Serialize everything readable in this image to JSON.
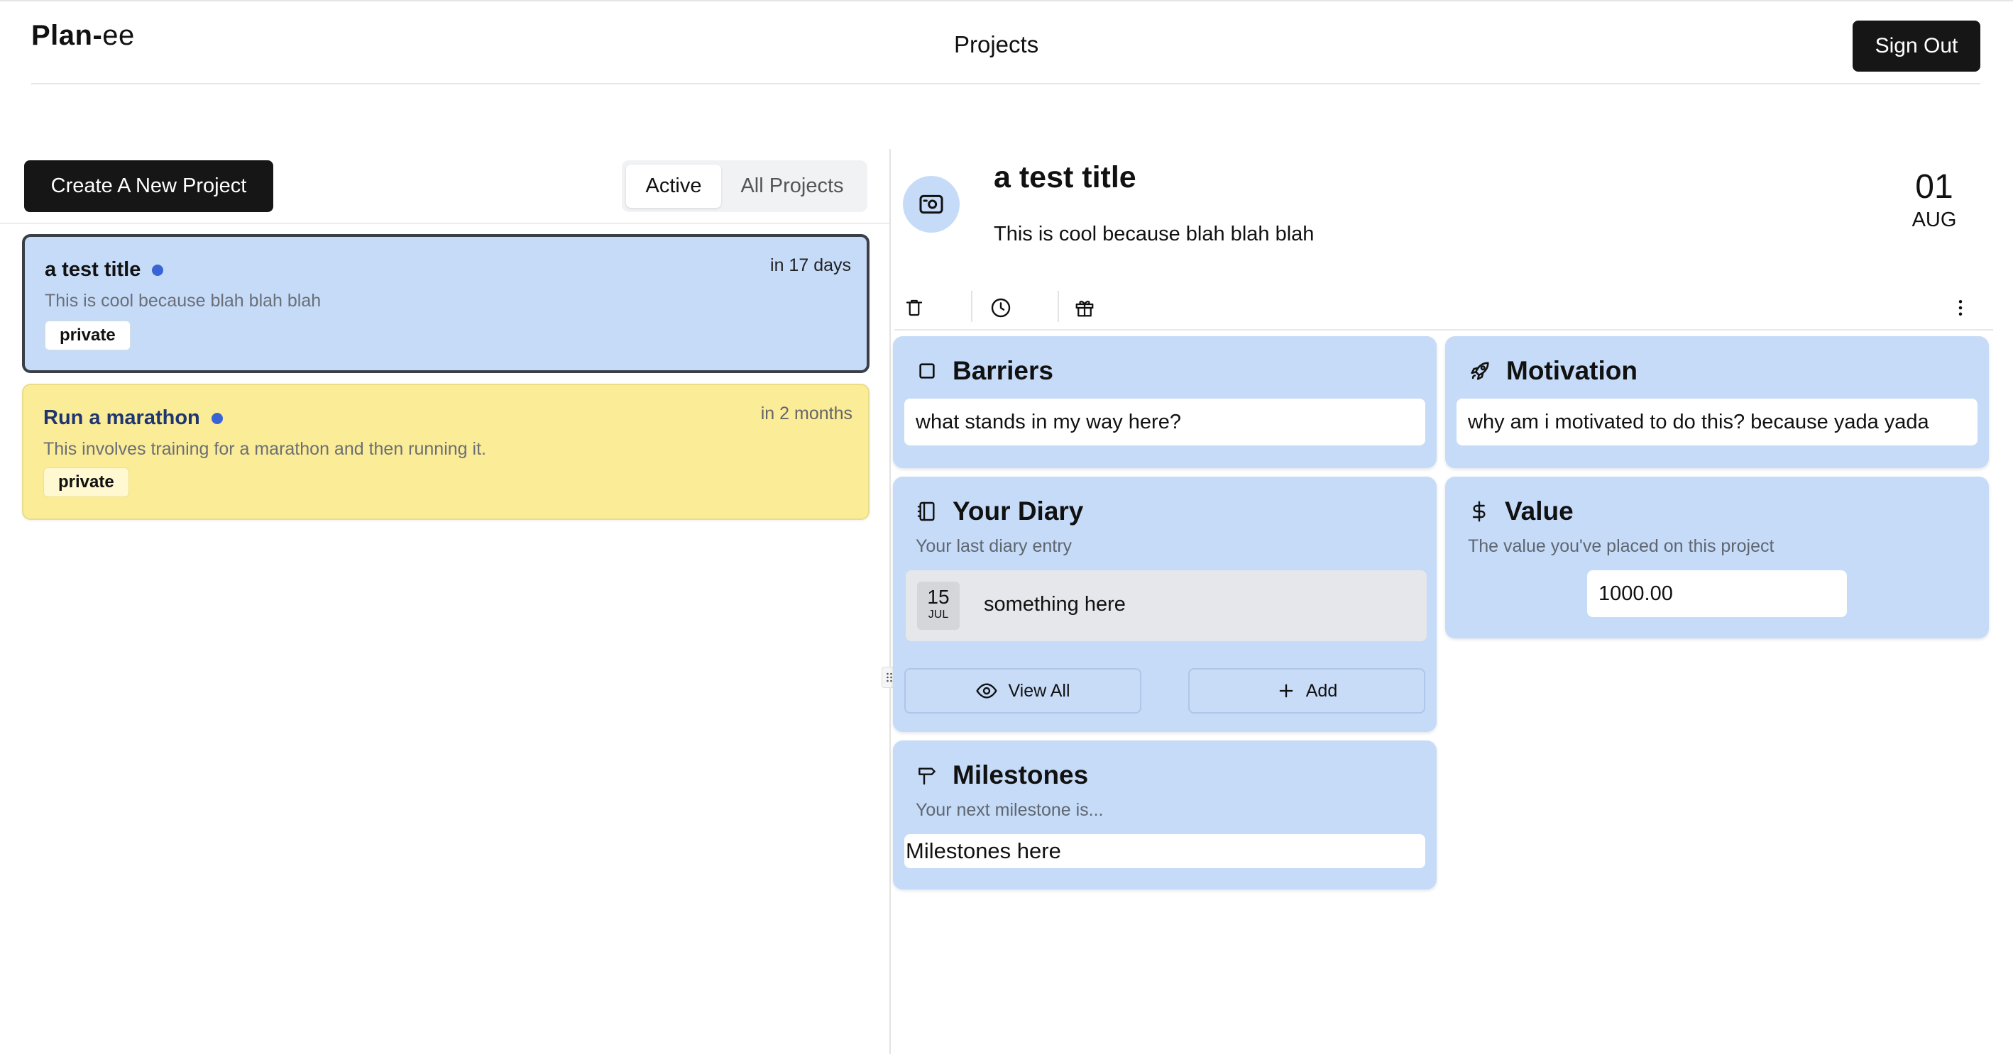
{
  "header": {
    "logo_bold": "Plan-",
    "logo_light": "ee",
    "title": "Projects",
    "signout_label": "Sign Out"
  },
  "left": {
    "create_label": "Create A New Project",
    "filter_tabs": [
      {
        "label": "Active",
        "selected": true
      },
      {
        "label": "All Projects",
        "selected": false
      }
    ],
    "projects": [
      {
        "title": "a test title",
        "description": "This is cool because blah blah blah",
        "due": "in 17 days",
        "badge": "private",
        "color": "#c5dbf8",
        "selected": true
      },
      {
        "title": "Run a marathon",
        "description": "This involves training for a marathon and then running it.",
        "due": "in 2 months",
        "badge": "private",
        "color": "#fbec98",
        "selected": false
      }
    ]
  },
  "detail": {
    "title": "a test title",
    "description": "This is cool because blah blah blah",
    "date_day": "01",
    "date_month": "AUG",
    "toolbar_icons": [
      "trash-icon",
      "clock-icon",
      "gift-icon",
      "more-vertical-icon"
    ],
    "barriers": {
      "title": "Barriers",
      "value": "what stands in my way here?"
    },
    "motivation": {
      "title": "Motivation",
      "value": "why am i motivated to do this? because yada yada"
    },
    "diary": {
      "title": "Your Diary",
      "subtitle": "Your last diary entry",
      "entry_day": "15",
      "entry_month": "JUL",
      "entry_text": "something here",
      "view_all_label": "View All",
      "add_label": "Add"
    },
    "value": {
      "title": "Value",
      "subtitle": "The value you've placed on this project",
      "amount": "1000.00"
    },
    "milestones": {
      "title": "Milestones",
      "subtitle": "Your next milestone is...",
      "value": "Milestones here"
    }
  },
  "colors": {
    "accent_blue": "#c5dbf8",
    "accent_yellow": "#fbec98",
    "dark": "#161616",
    "dot": "#3a64d6"
  }
}
